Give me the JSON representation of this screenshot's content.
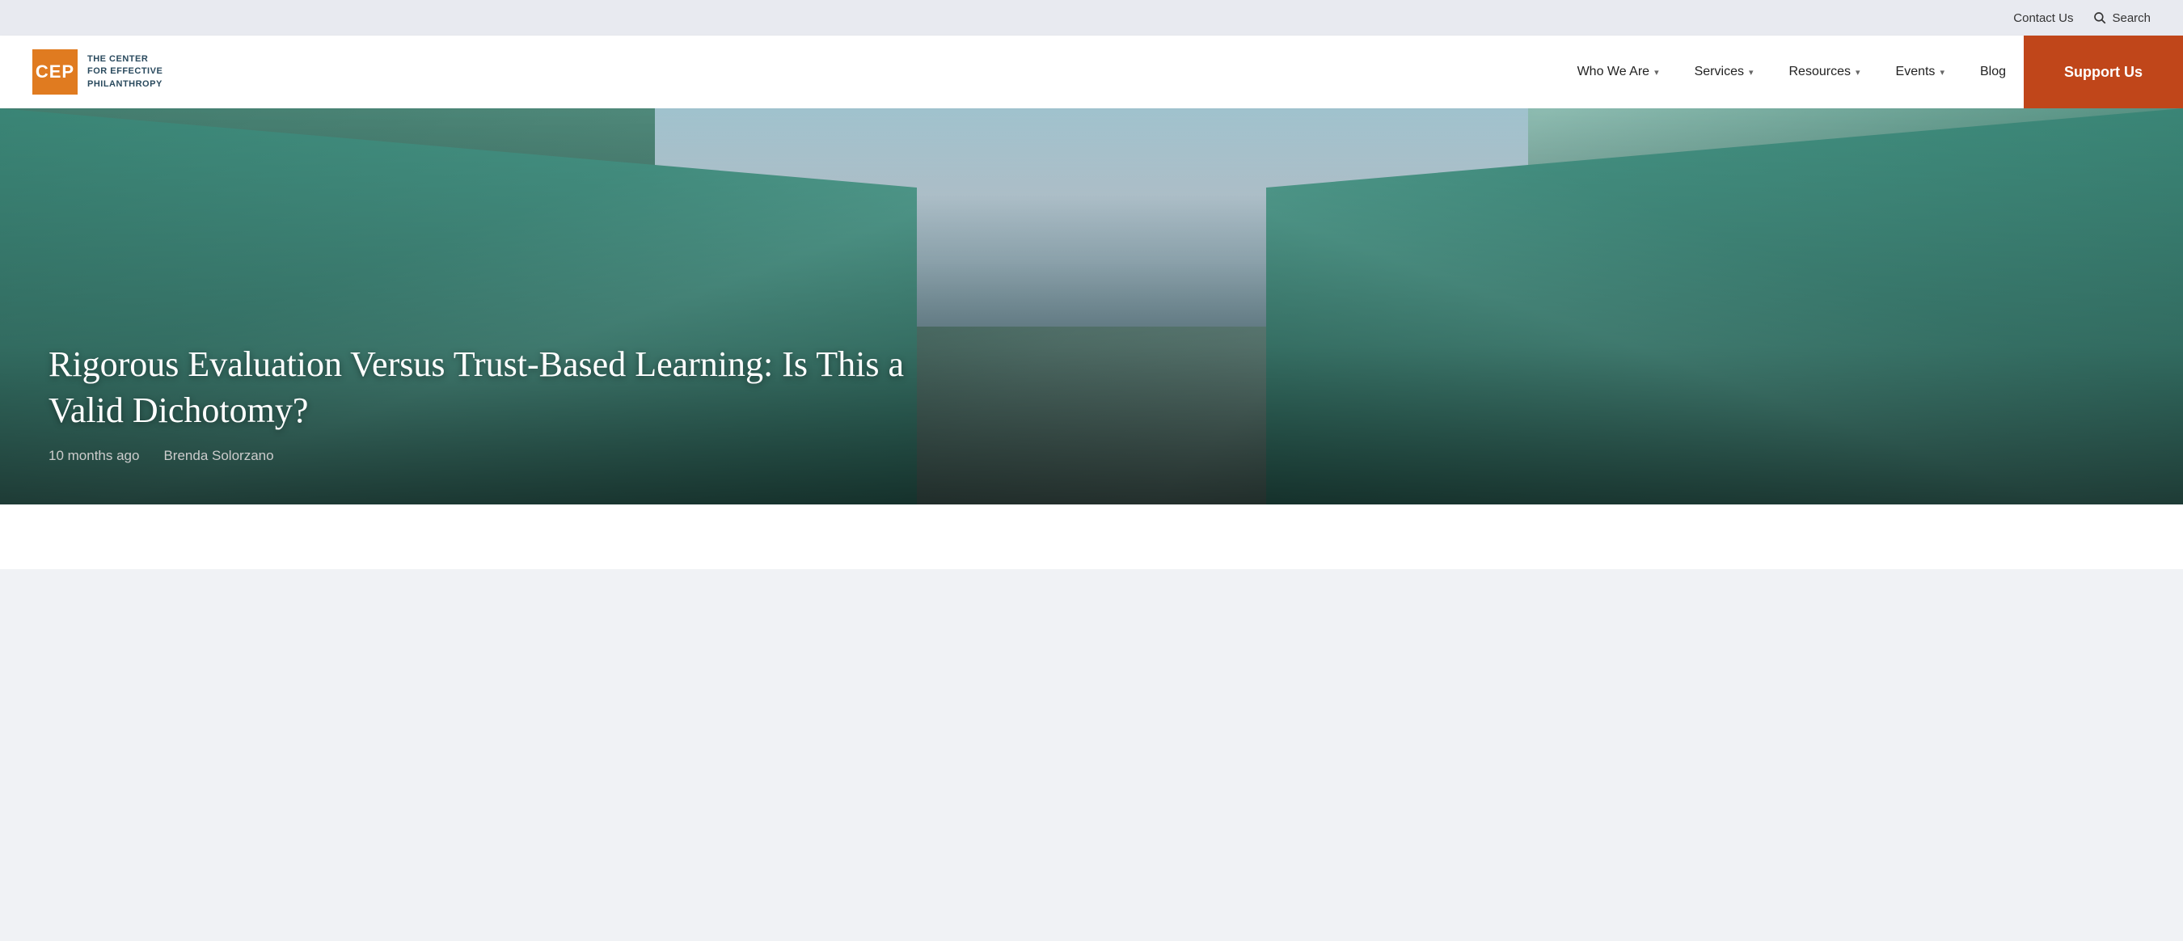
{
  "topbar": {
    "contact_label": "Contact Us",
    "search_label": "Search"
  },
  "logo": {
    "cep_text": "CEP",
    "line1": "THE CENTER",
    "line2": "FOR EFFECTIVE",
    "line3": "PHILANTHROPY"
  },
  "nav": {
    "items": [
      {
        "id": "who-we-are",
        "label": "Who We Are",
        "has_dropdown": true
      },
      {
        "id": "services",
        "label": "Services",
        "has_dropdown": true
      },
      {
        "id": "resources",
        "label": "Resources",
        "has_dropdown": true
      },
      {
        "id": "events",
        "label": "Events",
        "has_dropdown": true
      },
      {
        "id": "blog",
        "label": "Blog",
        "has_dropdown": false
      }
    ],
    "support_label": "Support Us"
  },
  "hero": {
    "title": "Rigorous Evaluation Versus Trust-Based Learning: Is This a Valid Dichotomy?",
    "time_ago": "10 months ago",
    "author": "Brenda Solorzano"
  }
}
